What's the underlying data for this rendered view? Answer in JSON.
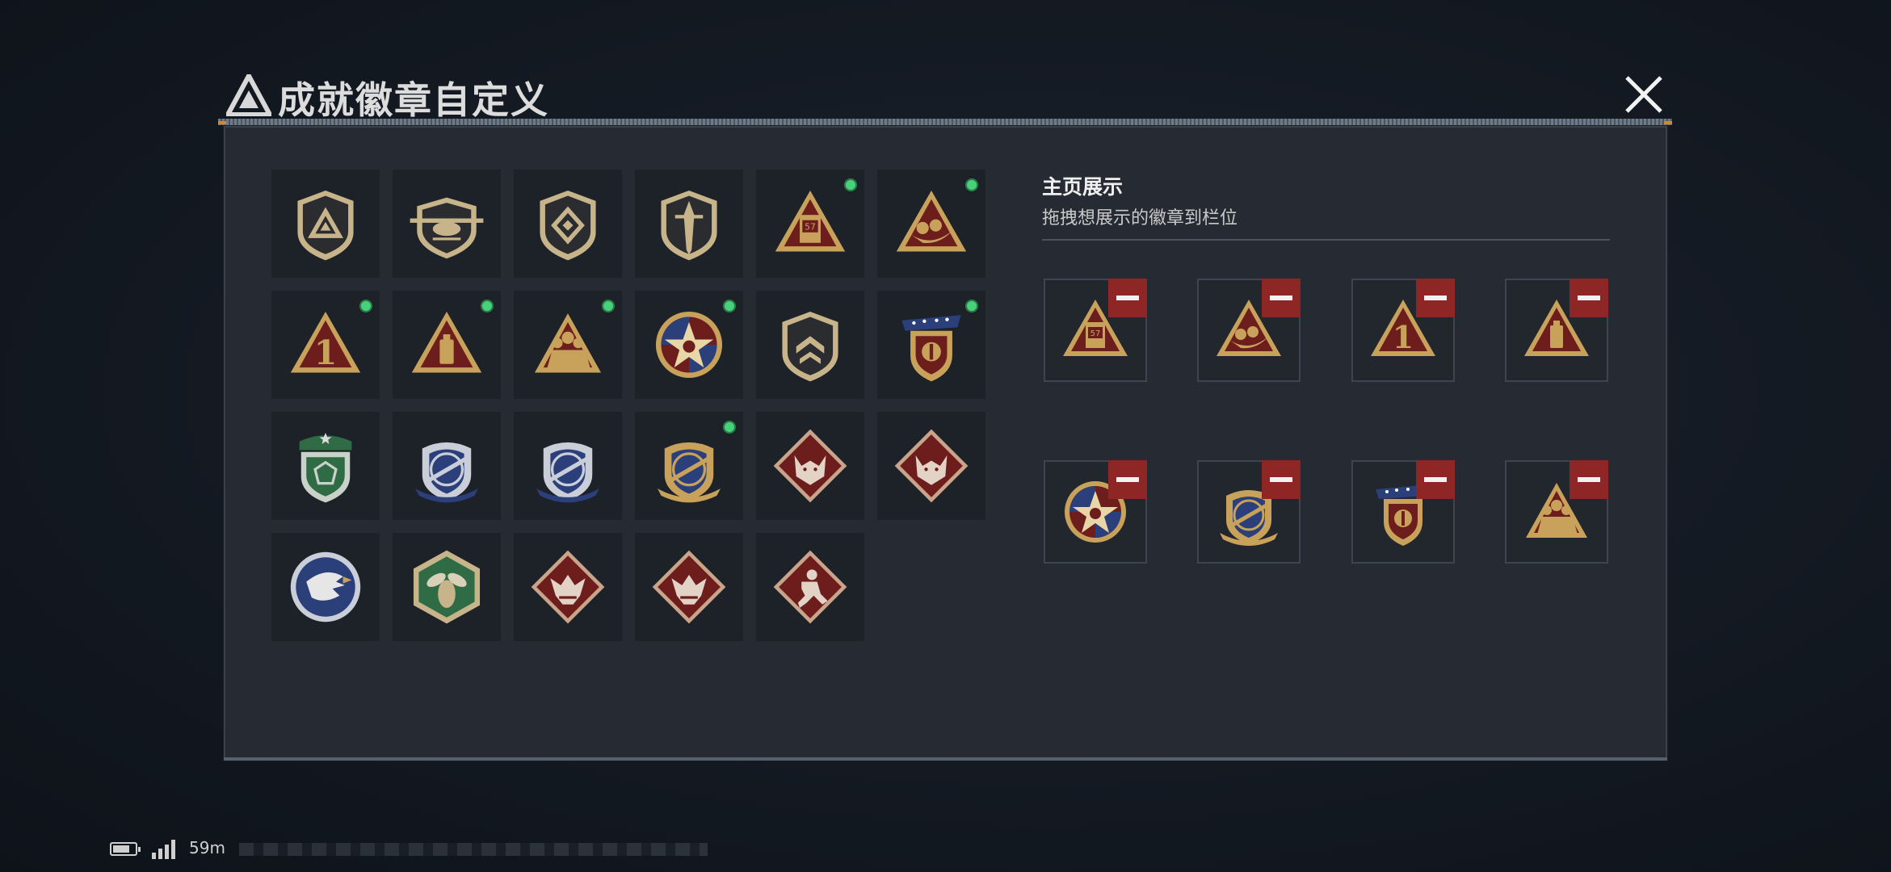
{
  "header": {
    "title": "成就徽章自定义",
    "logo_icon": "triangle-logo-icon",
    "close_icon": "close-icon"
  },
  "colors": {
    "new_dot": "#45d27a",
    "remove_button": "#8e2626",
    "gold": "#c8a25a",
    "maroon": "#6e1d1d",
    "navy": "#2b3f7a",
    "green": "#2f6b44"
  },
  "badge_collection": [
    {
      "icon": "shield-triangle-badge",
      "new": false
    },
    {
      "icon": "shield-helicopter-badge",
      "new": false
    },
    {
      "icon": "shield-diamond-badge",
      "new": false
    },
    {
      "icon": "shield-dagger-badge",
      "new": false
    },
    {
      "icon": "triangle-barrel-badge",
      "new": true
    },
    {
      "icon": "triangle-eggs-badge",
      "new": true
    },
    {
      "icon": "triangle-number-one-badge",
      "new": true
    },
    {
      "icon": "triangle-canister-badge",
      "new": true
    },
    {
      "icon": "triangle-soldiers-badge",
      "new": true
    },
    {
      "icon": "star-round-emblem-badge",
      "new": true
    },
    {
      "icon": "shield-chevron-badge",
      "new": false
    },
    {
      "icon": "laurel-stars-crest-badge",
      "new": true
    },
    {
      "icon": "green-crest-badge",
      "new": false
    },
    {
      "icon": "blue-crosshair-rifle-badge",
      "new": false
    },
    {
      "icon": "blue-crosshair-rifle-badge-2",
      "new": false
    },
    {
      "icon": "gold-crosshair-rifle-badge",
      "new": true
    },
    {
      "icon": "diamond-wolf-badge",
      "new": false
    },
    {
      "icon": "diamond-wolf-badge-2",
      "new": false
    },
    {
      "icon": "round-eagle-badge",
      "new": false
    },
    {
      "icon": "hexagon-hornet-badge",
      "new": false
    },
    {
      "icon": "diamond-dragon-badge",
      "new": false
    },
    {
      "icon": "diamond-dragon-badge-2",
      "new": false
    },
    {
      "icon": "diamond-runner-badge",
      "new": false
    }
  ],
  "display": {
    "title": "主页展示",
    "subtitle": "拖拽想展示的徽章到栏位",
    "slots": [
      {
        "icon": "triangle-barrel-badge"
      },
      {
        "icon": "triangle-eggs-badge"
      },
      {
        "icon": "triangle-number-one-badge"
      },
      {
        "icon": "triangle-canister-badge"
      },
      {
        "icon": "star-round-emblem-badge"
      },
      {
        "icon": "gold-crosshair-rifle-badge"
      },
      {
        "icon": "laurel-stars-crest-badge"
      },
      {
        "icon": "triangle-soldiers-badge"
      }
    ],
    "remove_icon": "minus-icon"
  },
  "status_bar": {
    "ping": "59m"
  }
}
